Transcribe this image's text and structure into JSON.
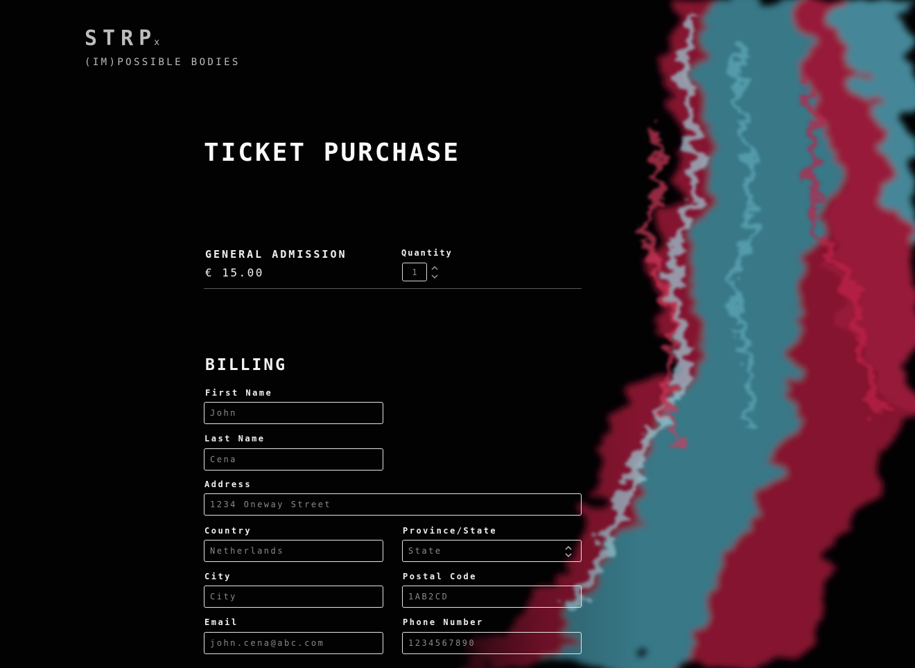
{
  "logo": {
    "name": "STRP",
    "sup": "x",
    "tagline": "(IM)POSSIBLE BODIES"
  },
  "page_title": "TICKET PURCHASE",
  "ticket": {
    "name": "GENERAL ADMISSION",
    "price": "€ 15.00",
    "quantity_label": "Quantity",
    "quantity_value": "1"
  },
  "billing": {
    "heading": "BILLING",
    "first_name": {
      "label": "First Name",
      "placeholder": "John"
    },
    "last_name": {
      "label": "Last Name",
      "placeholder": "Cena"
    },
    "address": {
      "label": "Address",
      "placeholder": "1234 Oneway Street"
    },
    "country": {
      "label": "Country",
      "placeholder": "Netherlands"
    },
    "province": {
      "label": "Province/State",
      "value": "State"
    },
    "city": {
      "label": "City",
      "placeholder": "City"
    },
    "postal_code": {
      "label": "Postal Code",
      "placeholder": "1AB2CD"
    },
    "email": {
      "label": "Email",
      "placeholder": "john.cena@abc.com"
    },
    "phone": {
      "label": "Phone Number",
      "placeholder": "1234567890"
    }
  },
  "colors": {
    "background": "#020203",
    "smoke_red": "#b3183c",
    "smoke_teal": "#3e8595"
  }
}
